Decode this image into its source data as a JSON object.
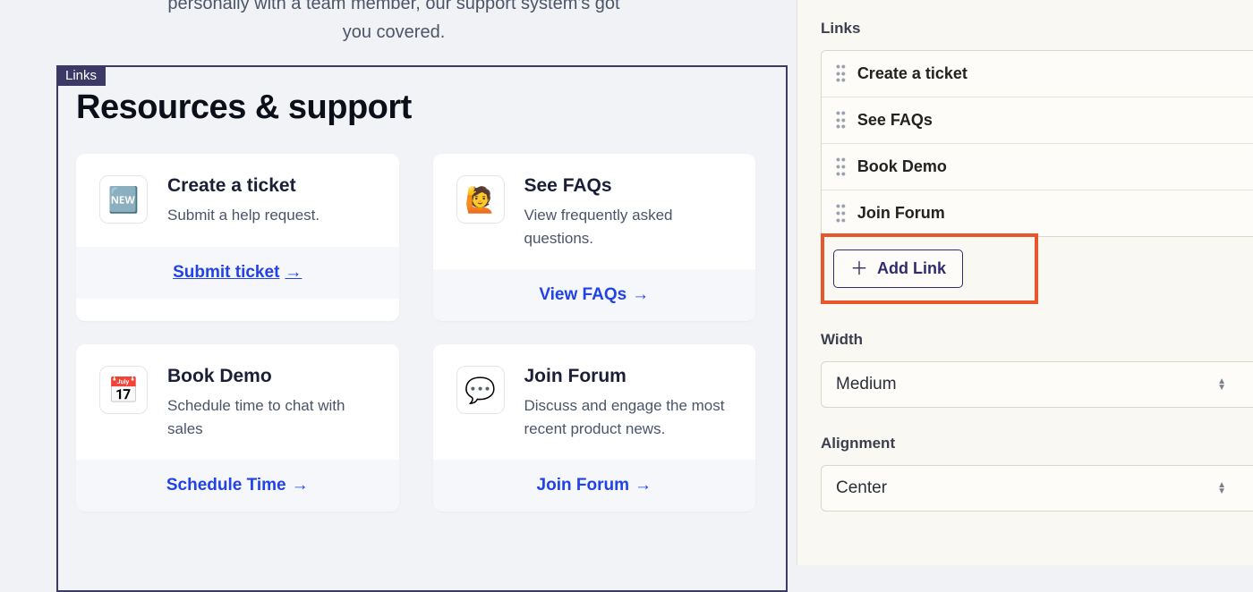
{
  "intro": {
    "line1": "personally with a team member, our support system's got",
    "line2": "you covered."
  },
  "preview": {
    "tag": "Links",
    "title": "Resources & support",
    "cards": [
      {
        "icon": "🆕",
        "title": "Create a ticket",
        "desc": "Submit a help request.",
        "action": "Submit ticket",
        "underlined": true
      },
      {
        "icon": "🙋",
        "title": "See FAQs",
        "desc": "View frequently asked questions.",
        "action": "View FAQs",
        "underlined": false
      },
      {
        "icon": "📅",
        "title": "Book Demo",
        "desc": "Schedule time to chat with sales",
        "action": "Schedule Time",
        "underlined": false
      },
      {
        "icon": "💬",
        "title": "Join Forum",
        "desc": "Discuss and engage the most recent product news.",
        "action": "Join Forum",
        "underlined": false
      }
    ]
  },
  "sidebar": {
    "links_label": "Links",
    "items": [
      {
        "label": "Create a ticket"
      },
      {
        "label": "See FAQs"
      },
      {
        "label": "Book Demo"
      },
      {
        "label": "Join Forum"
      }
    ],
    "add_link_label": "Add Link",
    "width_label": "Width",
    "width_value": "Medium",
    "alignment_label": "Alignment",
    "alignment_value": "Center"
  }
}
